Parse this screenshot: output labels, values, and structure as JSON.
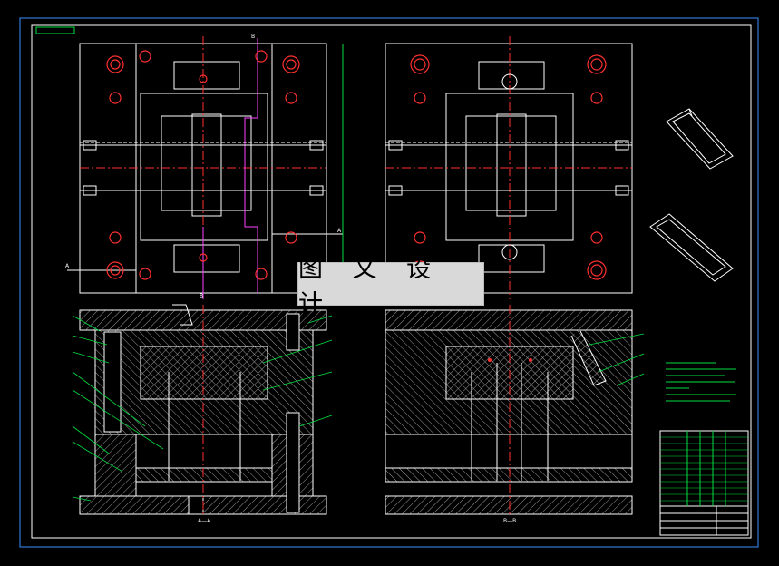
{
  "drawing": {
    "type": "mould-assembly-drawing",
    "colors": {
      "background": "#000000",
      "outline": "#ffffff",
      "frame": "#3a8fff",
      "centerline": "#ff3030",
      "section_line": "#ff40ff",
      "leader": "#00e040",
      "hatch": "#bdbdbd"
    },
    "views": [
      "top-view-moving-half",
      "top-view-fixed-half",
      "section-A-A",
      "section-B-B",
      "isometric-part-1",
      "isometric-part-2",
      "title-block"
    ],
    "section_labels": {
      "left": "A—A",
      "right": "B—B"
    },
    "cut_markers": {
      "a1": "A",
      "a2": "A",
      "b1": "B",
      "b2": "B"
    }
  },
  "watermark": {
    "text": "图 文 设 计"
  }
}
